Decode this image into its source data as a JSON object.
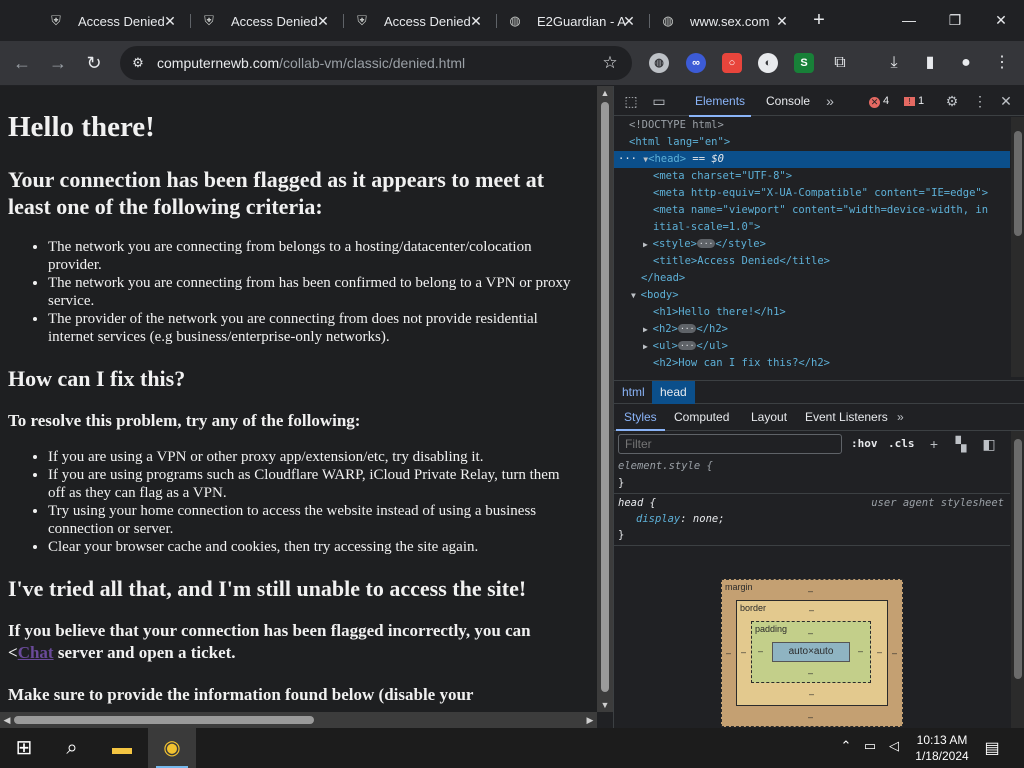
{
  "tabs": [
    {
      "title": "Access Denied",
      "icon": "shield-icon"
    },
    {
      "title": "Access Denied",
      "icon": "shield-icon"
    },
    {
      "title": "Access Denied",
      "icon": "shield-icon"
    },
    {
      "title": "E2Guardian - A",
      "icon": "globe-icon"
    },
    {
      "title": "www.sex.com",
      "icon": "globe-icon"
    }
  ],
  "address": {
    "host": "computernewb.com",
    "path": "/collab-vm/classic/denied.html"
  },
  "page": {
    "h1": "Hello there!",
    "h2_flagged": "Your connection has been flagged as it appears to meet at least one of the following criteria:",
    "criteria": [
      "The network you are connecting from belongs to a hosting/datacenter/colocation provider.",
      "The network you are connecting from has been confirmed to belong to a VPN or proxy service.",
      "The provider of the network you are connecting from does not provide residential internet services (e.g business/enterprise-only networks)."
    ],
    "h2_fix": "How can I fix this?",
    "h3_resolve": "To resolve this problem, try any of the following:",
    "fixes": [
      "If you are using a VPN or other proxy app/extension/etc, try disabling it.",
      "If you are using programs such as Cloudflare WARP, iCloud Private Relay, turn them off as they can flag as a VPN.",
      "Try using your home connection to access the website instead of using a business connection or server.",
      "Clear your browser cache and cookies, then try accessing the site again."
    ],
    "h2_tried": "I've tried all that, and I'm still unable to access the site!",
    "incorrect_before": "If you believe that your connection has been flagged incorrectly, you can <",
    "chat_link": "Chat",
    "incorrect_after": " server and open a ticket.",
    "make_sure": "Make sure to provide the information found below (disable your"
  },
  "devtools": {
    "tabs": [
      "Elements",
      "Console"
    ],
    "errors": "4",
    "issues": "1",
    "dom": {
      "doctype": "<!DOCTYPE html>",
      "html_open": "<html lang=\"en\">",
      "head_selected_suffix": "== $0",
      "meta1": "<meta charset=\"UTF-8\">",
      "meta2": "<meta http-equiv=\"X-UA-Compatible\" content=\"IE=edge\">",
      "meta3a": "<meta name=\"viewport\" content=\"width=device-width, in",
      "meta3b": "itial-scale=1.0\">",
      "style": "<style>",
      "style_close": "</style>",
      "title": "<title>Access Denied</title>",
      "head_close": "</head>",
      "body_open": "<body>",
      "h1": "<h1>Hello there!</h1>",
      "h2": "<h2>",
      "h2_close": "</h2>",
      "ul": "<ul>",
      "ul_close": "</ul>",
      "h2_fix": "<h2>How can I fix this?</h2>"
    },
    "breadcrumbs": [
      "html",
      "head"
    ],
    "styles_tabs": [
      "Styles",
      "Computed",
      "Layout",
      "Event Listeners"
    ],
    "filter_placeholder": "Filter",
    "hov": ":hov",
    "cls": ".cls",
    "element_style": "element.style {",
    "close_brace": "}",
    "head_rule": "head {",
    "ua_label": "user agent stylesheet",
    "display_prop": "display",
    "display_val": "none;",
    "box": {
      "margin": "margin",
      "border": "border",
      "padding": "padding",
      "content": "auto×auto",
      "dash": "–"
    }
  },
  "taskbar": {
    "time": "10:13 AM",
    "date": "1/18/2024"
  }
}
